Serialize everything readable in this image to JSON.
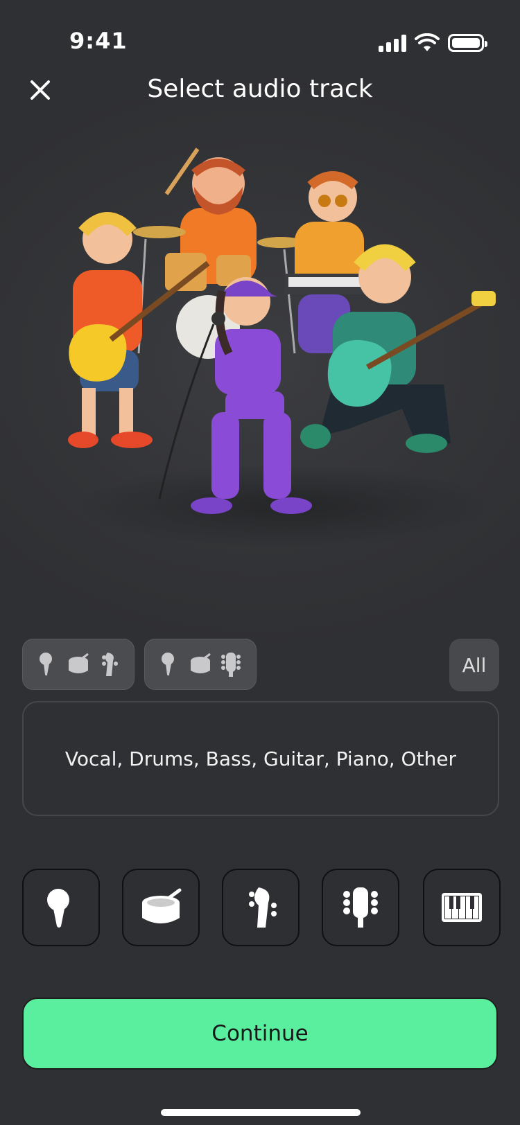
{
  "status_bar": {
    "time": "9:41"
  },
  "header": {
    "title": "Select audio track"
  },
  "presets": {
    "preset_1": [
      "microphone-icon",
      "drum-icon",
      "bass-headstock-icon"
    ],
    "preset_2": [
      "microphone-icon",
      "drum-icon",
      "guitar-headstock-icon"
    ],
    "all_label": "All"
  },
  "selection_text": "Vocal, Drums, Bass, Guitar, Piano, Other",
  "instruments": [
    "microphone-icon",
    "drum-icon",
    "bass-headstock-icon",
    "guitar-headstock-icon",
    "piano-icon"
  ],
  "continue_label": "Continue",
  "colors": {
    "accent": "#5aef9e",
    "background": "#323336",
    "tile": "#2e2f32"
  }
}
